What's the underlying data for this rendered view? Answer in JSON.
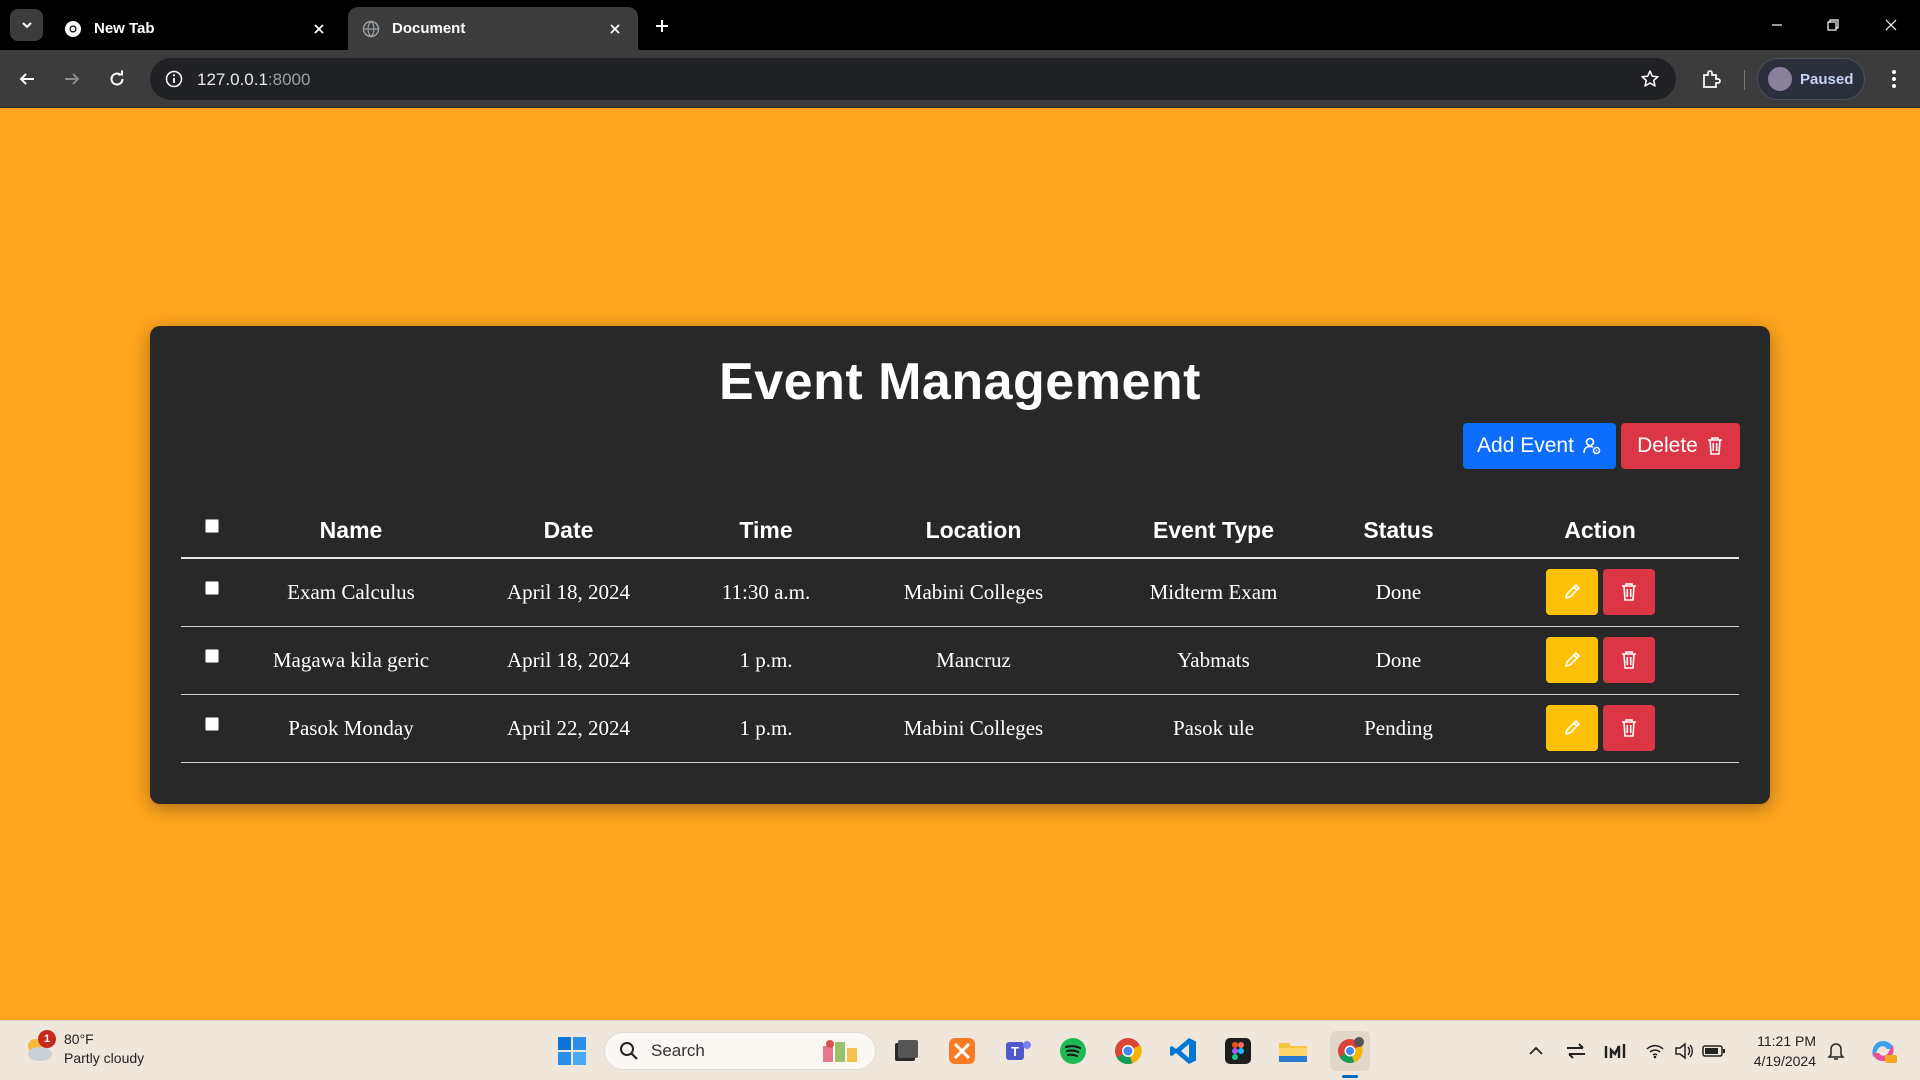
{
  "browser": {
    "tabs": [
      {
        "title": "New Tab",
        "active": false
      },
      {
        "title": "Document",
        "active": true
      }
    ],
    "url_host": "127.0.0.1",
    "url_port": ":8000",
    "profile_label": "Paused"
  },
  "page": {
    "title": "Event Management",
    "add_button": "Add Event",
    "delete_button": "Delete",
    "columns": [
      "Name",
      "Date",
      "Time",
      "Location",
      "Event Type",
      "Status",
      "Action"
    ],
    "rows": [
      {
        "name": "Exam Calculus",
        "date": "April 18, 2024",
        "time": "11:30 a.m.",
        "location": "Mabini Colleges",
        "type": "Midterm Exam",
        "status": "Done"
      },
      {
        "name": "Magawa kila geric",
        "date": "April 18, 2024",
        "time": "1 p.m.",
        "location": "Mancruz",
        "type": "Yabmats",
        "status": "Done"
      },
      {
        "name": "Pasok Monday",
        "date": "April 22, 2024",
        "time": "1 p.m.",
        "location": "Mabini Colleges",
        "type": "Pasok ule",
        "status": "Pending"
      }
    ],
    "colors": {
      "background": "#ffa51f",
      "card": "#282828",
      "add": "#0d6efd",
      "delete": "#dc3545",
      "edit": "#ffc107"
    }
  },
  "taskbar": {
    "weather_temp": "80°F",
    "weather_desc": "Partly cloudy",
    "weather_badge": "1",
    "search_label": "Search",
    "time": "11:21 PM",
    "date": "4/19/2024"
  }
}
